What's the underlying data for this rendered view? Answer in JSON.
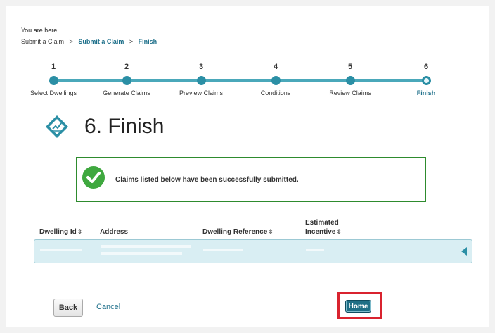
{
  "location": {
    "you_are_here": "You are here",
    "breadcrumb": [
      {
        "label": "Submit a Claim",
        "active": false
      },
      {
        "label": "Submit a Claim",
        "active": true
      },
      {
        "label": "Finish",
        "active": true
      }
    ],
    "separator": ">"
  },
  "steps": [
    {
      "num": "1",
      "label": "Select Dwellings"
    },
    {
      "num": "2",
      "label": "Generate Claims"
    },
    {
      "num": "3",
      "label": "Preview Claims"
    },
    {
      "num": "4",
      "label": "Conditions"
    },
    {
      "num": "5",
      "label": "Review Claims"
    },
    {
      "num": "6",
      "label": "Finish"
    }
  ],
  "current_step": 6,
  "page_title": "6. Finish",
  "success": {
    "message": "Claims listed below have been successfully submitted."
  },
  "table": {
    "headers": {
      "dwelling_id": "Dwelling Id",
      "address": "Address",
      "dwelling_reference": "Dwelling Reference",
      "estimated_incentive_1": "Estimated",
      "estimated_incentive_2": "Incentive"
    },
    "sort_icon": "⇕"
  },
  "footer": {
    "back_label": "Back",
    "cancel_label": "Cancel",
    "home_label": "Home"
  },
  "colors": {
    "accent": "#2b8fa5",
    "success": "#3fa83f",
    "highlight": "#d9232f"
  }
}
